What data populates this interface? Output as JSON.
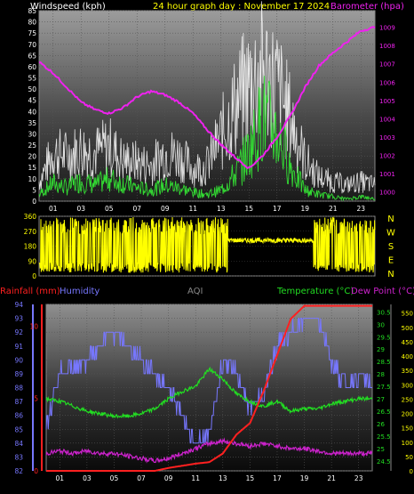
{
  "header": {
    "wind_label": "Windspeed (kph)",
    "date_label": "24 hour graph day : November 17 2024",
    "baro_label": "Barometer (hpa)"
  },
  "colors": {
    "white": "#ffffff",
    "gust": "#ffffff",
    "avg": "#33dd33",
    "baro": "#ee22ee",
    "yellow": "#ffff00",
    "rain": "#ff2020",
    "humidity": "#7777ff",
    "temp": "#22dd22",
    "dew": "#cc22cc",
    "aqi": "#888888",
    "grid": "#555555"
  },
  "chart_data": [
    {
      "type": "line",
      "title": "24 hour graph day : November 17 2024",
      "ylabel": "Windspeed (kph)",
      "y2label": "Barometer (hpa)",
      "ylim": [
        0,
        85
      ],
      "y2lim": [
        999.5,
        1009.9
      ],
      "y_ticks": [
        "0",
        "5",
        "10",
        "15",
        "20",
        "25",
        "30",
        "35",
        "40",
        "45",
        "50",
        "55",
        "60",
        "65",
        "70",
        "75",
        "80",
        "85"
      ],
      "y2_ticks": [
        "1000",
        "1001",
        "1002",
        "1003",
        "1004",
        "1005",
        "1006",
        "1007",
        "1008",
        "1009"
      ],
      "x_ticks": [
        "01",
        "03",
        "05",
        "07",
        "09",
        "11",
        "13",
        "15",
        "17",
        "19",
        "21",
        "23"
      ],
      "series": [
        {
          "role": "gust",
          "points": [
            [
              0,
              12
            ],
            [
              1,
              30
            ],
            [
              2,
              28
            ],
            [
              3,
              32
            ],
            [
              4,
              30
            ],
            [
              5,
              34
            ],
            [
              6,
              25
            ],
            [
              7,
              24
            ],
            [
              8,
              22
            ],
            [
              9,
              30
            ],
            [
              10,
              28
            ],
            [
              11,
              20
            ],
            [
              12,
              22
            ],
            [
              13,
              40
            ],
            [
              14,
              58
            ],
            [
              15,
              72
            ],
            [
              16,
              80
            ],
            [
              17,
              70
            ],
            [
              18,
              50
            ],
            [
              19,
              25
            ],
            [
              20,
              15
            ],
            [
              21,
              12
            ],
            [
              22,
              10
            ],
            [
              23,
              12
            ],
            [
              24,
              10
            ]
          ]
        },
        {
          "role": "avg",
          "points": [
            [
              0,
              3
            ],
            [
              1,
              8
            ],
            [
              2,
              6
            ],
            [
              3,
              9
            ],
            [
              4,
              7
            ],
            [
              5,
              10
            ],
            [
              6,
              8
            ],
            [
              7,
              6
            ],
            [
              8,
              5
            ],
            [
              9,
              7
            ],
            [
              10,
              6
            ],
            [
              11,
              4
            ],
            [
              12,
              3
            ],
            [
              13,
              5
            ],
            [
              14,
              12
            ],
            [
              15,
              22
            ],
            [
              16,
              38
            ],
            [
              17,
              30
            ],
            [
              18,
              15
            ],
            [
              19,
              5
            ],
            [
              20,
              3
            ],
            [
              21,
              2
            ],
            [
              22,
              1
            ],
            [
              23,
              2
            ],
            [
              24,
              1
            ]
          ]
        },
        {
          "role": "baro",
          "points": [
            [
              0,
              1007.1
            ],
            [
              1,
              1006.5
            ],
            [
              2,
              1005.7
            ],
            [
              3,
              1004.9
            ],
            [
              4,
              1004.5
            ],
            [
              5,
              1004.3
            ],
            [
              6,
              1004.6
            ],
            [
              7,
              1005.2
            ],
            [
              8,
              1005.5
            ],
            [
              9,
              1005.3
            ],
            [
              10,
              1004.9
            ],
            [
              11,
              1004.3
            ],
            [
              12,
              1003.4
            ],
            [
              13,
              1002.6
            ],
            [
              14,
              1001.9
            ],
            [
              15,
              1001.3
            ],
            [
              16,
              1002.0
            ],
            [
              17,
              1003.0
            ],
            [
              18,
              1004.2
            ],
            [
              19,
              1005.7
            ],
            [
              20,
              1006.9
            ],
            [
              21,
              1007.6
            ],
            [
              22,
              1008.2
            ],
            [
              23,
              1008.8
            ],
            [
              24,
              1009.0
            ]
          ]
        }
      ]
    },
    {
      "type": "scatter",
      "ylabel": "Wind direction",
      "ylim": [
        0,
        360
      ],
      "y_ticks": [
        "0",
        "90",
        "180",
        "270",
        "360"
      ],
      "dir_labels": [
        "N",
        "W",
        "S",
        "E",
        "N"
      ],
      "series": [
        {
          "role": "direction",
          "points": [
            [
              0,
              300
            ],
            [
              2,
              200
            ],
            [
              4,
              330
            ],
            [
              6,
              250
            ],
            [
              8,
              300
            ],
            [
              10,
              240
            ],
            [
              12,
              300
            ],
            [
              13,
              310
            ],
            [
              14,
              225
            ],
            [
              16,
              220
            ],
            [
              18,
              230
            ],
            [
              19,
              240
            ],
            [
              20,
              320
            ],
            [
              22,
              300
            ],
            [
              24,
              300
            ]
          ]
        }
      ]
    },
    {
      "type": "line",
      "rain_label": "Rainfall (mm)",
      "humidity_label": "Humidity",
      "aqi_label": "AQI",
      "temp_label": "Temperature (°C)",
      "dew_label": "Dew Point (°C)",
      "humidity_lim": [
        82,
        94
      ],
      "humidity_ticks": [
        "82",
        "83",
        "84",
        "85",
        "86",
        "87",
        "88",
        "89",
        "90",
        "91",
        "92",
        "93",
        "94"
      ],
      "rain_lim": [
        0,
        11.5
      ],
      "rain_ticks": [
        "0",
        "5",
        "10"
      ],
      "temp_lim": [
        24.1,
        30.8
      ],
      "temp_ticks": [
        "24.5",
        "25",
        "25.5",
        "26",
        "26.5",
        "27",
        "27.5",
        "28",
        "28.5",
        "29",
        "29.5",
        "30",
        "30.5"
      ],
      "aqi_lim": [
        0,
        580
      ],
      "aqi_ticks": [
        "0",
        "50",
        "100",
        "150",
        "200",
        "250",
        "300",
        "350",
        "400",
        "450",
        "500",
        "550"
      ],
      "x_ticks": [
        "01",
        "03",
        "05",
        "07",
        "09",
        "11",
        "13",
        "15",
        "17",
        "19",
        "21",
        "23"
      ],
      "series": [
        {
          "role": "rain",
          "points": [
            [
              0,
              0
            ],
            [
              8,
              0
            ],
            [
              9,
              0.2
            ],
            [
              11,
              0.5
            ],
            [
              12,
              0.6
            ],
            [
              13,
              1.2
            ],
            [
              14,
              2.5
            ],
            [
              15,
              3.3
            ],
            [
              16,
              5.5
            ],
            [
              17,
              8.0
            ],
            [
              18,
              10.5
            ],
            [
              19,
              11.4
            ],
            [
              24,
              11.4
            ]
          ]
        },
        {
          "role": "humidity",
          "points": [
            [
              0,
              85
            ],
            [
              1,
              89
            ],
            [
              2,
              89.5
            ],
            [
              3,
              90
            ],
            [
              4,
              91
            ],
            [
              5,
              92
            ],
            [
              6,
              91
            ],
            [
              7,
              90
            ],
            [
              8,
              89
            ],
            [
              9,
              88
            ],
            [
              10,
              86
            ],
            [
              11,
              84
            ],
            [
              12,
              84.5
            ],
            [
              13,
              90
            ],
            [
              14,
              89
            ],
            [
              15,
              86.5
            ],
            [
              16,
              87.5
            ],
            [
              17,
              91
            ],
            [
              18,
              92
            ],
            [
              19,
              93
            ],
            [
              20,
              93
            ],
            [
              21,
              90
            ],
            [
              22,
              88
            ],
            [
              23,
              89
            ],
            [
              24,
              88
            ]
          ]
        },
        {
          "role": "temp",
          "points": [
            [
              0,
              27.0
            ],
            [
              1,
              26.9
            ],
            [
              2,
              26.7
            ],
            [
              3,
              26.5
            ],
            [
              4,
              26.4
            ],
            [
              5,
              26.3
            ],
            [
              6,
              26.3
            ],
            [
              7,
              26.4
            ],
            [
              8,
              26.6
            ],
            [
              9,
              27.0
            ],
            [
              10,
              27.3
            ],
            [
              11,
              27.5
            ],
            [
              12,
              28.2
            ],
            [
              13,
              27.8
            ],
            [
              14,
              27.2
            ],
            [
              15,
              26.9
            ],
            [
              16,
              26.7
            ],
            [
              17,
              26.9
            ],
            [
              18,
              26.5
            ],
            [
              19,
              26.6
            ],
            [
              20,
              26.6
            ],
            [
              21,
              26.8
            ],
            [
              22,
              26.9
            ],
            [
              23,
              27.0
            ],
            [
              24,
              27.0
            ]
          ]
        },
        {
          "role": "dew",
          "points": [
            [
              0,
              24.8
            ],
            [
              1,
              24.9
            ],
            [
              2,
              24.8
            ],
            [
              3,
              24.9
            ],
            [
              4,
              24.8
            ],
            [
              5,
              24.8
            ],
            [
              6,
              24.7
            ],
            [
              7,
              24.6
            ],
            [
              8,
              24.5
            ],
            [
              9,
              24.6
            ],
            [
              10,
              24.8
            ],
            [
              11,
              25.0
            ],
            [
              12,
              25.2
            ],
            [
              13,
              25.3
            ],
            [
              14,
              25.2
            ],
            [
              15,
              25.1
            ],
            [
              16,
              25.2
            ],
            [
              17,
              25.1
            ],
            [
              18,
              25.0
            ],
            [
              19,
              25.0
            ],
            [
              20,
              24.9
            ],
            [
              21,
              24.8
            ],
            [
              22,
              24.8
            ],
            [
              23,
              24.8
            ],
            [
              24,
              24.8
            ]
          ]
        }
      ]
    }
  ]
}
